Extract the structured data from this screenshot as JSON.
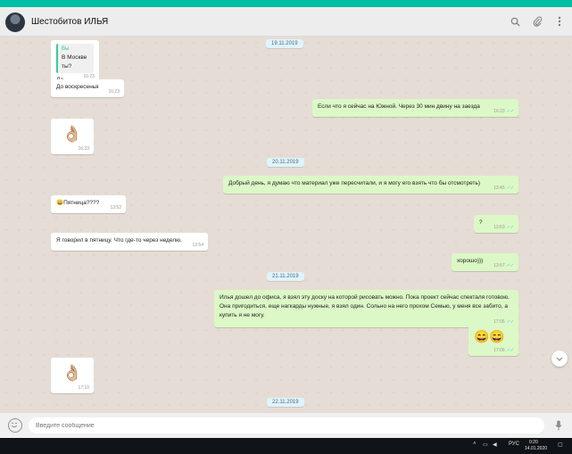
{
  "header": {
    "contact_name": "Шестобитов ИЛЬЯ"
  },
  "messages": {
    "quote_author": "Вы",
    "quote_text": "В Москве ты?",
    "reply_text": "Да",
    "reply_time": "16:23",
    "m2_text": "До воскресенья",
    "m2_time": "16:23",
    "m3_text": "Если что я сейчас на Южной. Через 30 мин двину на заезда",
    "m3_time": "16:33",
    "m4_emoji": "👌🏼",
    "m4_time": "16:33",
    "m5_text": "Добрый день, я думаю что материал уже пересчитали, и я могу его взять что бы отсмотреть)",
    "m5_time": "13:45",
    "m6_text": "😄Пятница????",
    "m6_time": "13:52",
    "m7_text": "?",
    "m7_time": "13:53",
    "m8_text": "Я говорил в пятницу. Что где-то через неделю.",
    "m8_time": "13:54",
    "m9_text": "хорошо)))",
    "m9_time": "13:57",
    "m10_text": "Илья дошел до офиса, я взял эту доску на которой рисовать можно. Пока проект сейчас спекталя готовою. Она пригодиться, еще нагкарды нужные, я взял один. Сольно на него прохом Семью, у меня все забито, а купить я не могу.",
    "m10_time": "17:06",
    "m11_emoji": "😄😄",
    "m11_time": "17:06",
    "m12_emoji": "👌🏼",
    "m12_time": "17:10"
  },
  "dates": {
    "d1": "19.11.2019",
    "d2": "20.11.2019",
    "d3": "21.11.2019",
    "d4": "22.11.2019"
  },
  "footer": {
    "placeholder": "Введите сообщение"
  },
  "taskbar": {
    "lang": "РУС",
    "time": "0:20",
    "date": "14.01.2020"
  },
  "colors": {
    "accent": "#00bfa5",
    "outgoing": "#dcf8c6",
    "incoming": "#ffffff",
    "tick": "#4fc3f7"
  },
  "icons": {
    "search": "search-icon",
    "attach": "paperclip-icon",
    "menu": "more-vertical-icon",
    "emoji": "smiley-icon",
    "mic": "microphone-icon",
    "scroll": "chevron-down-icon"
  }
}
